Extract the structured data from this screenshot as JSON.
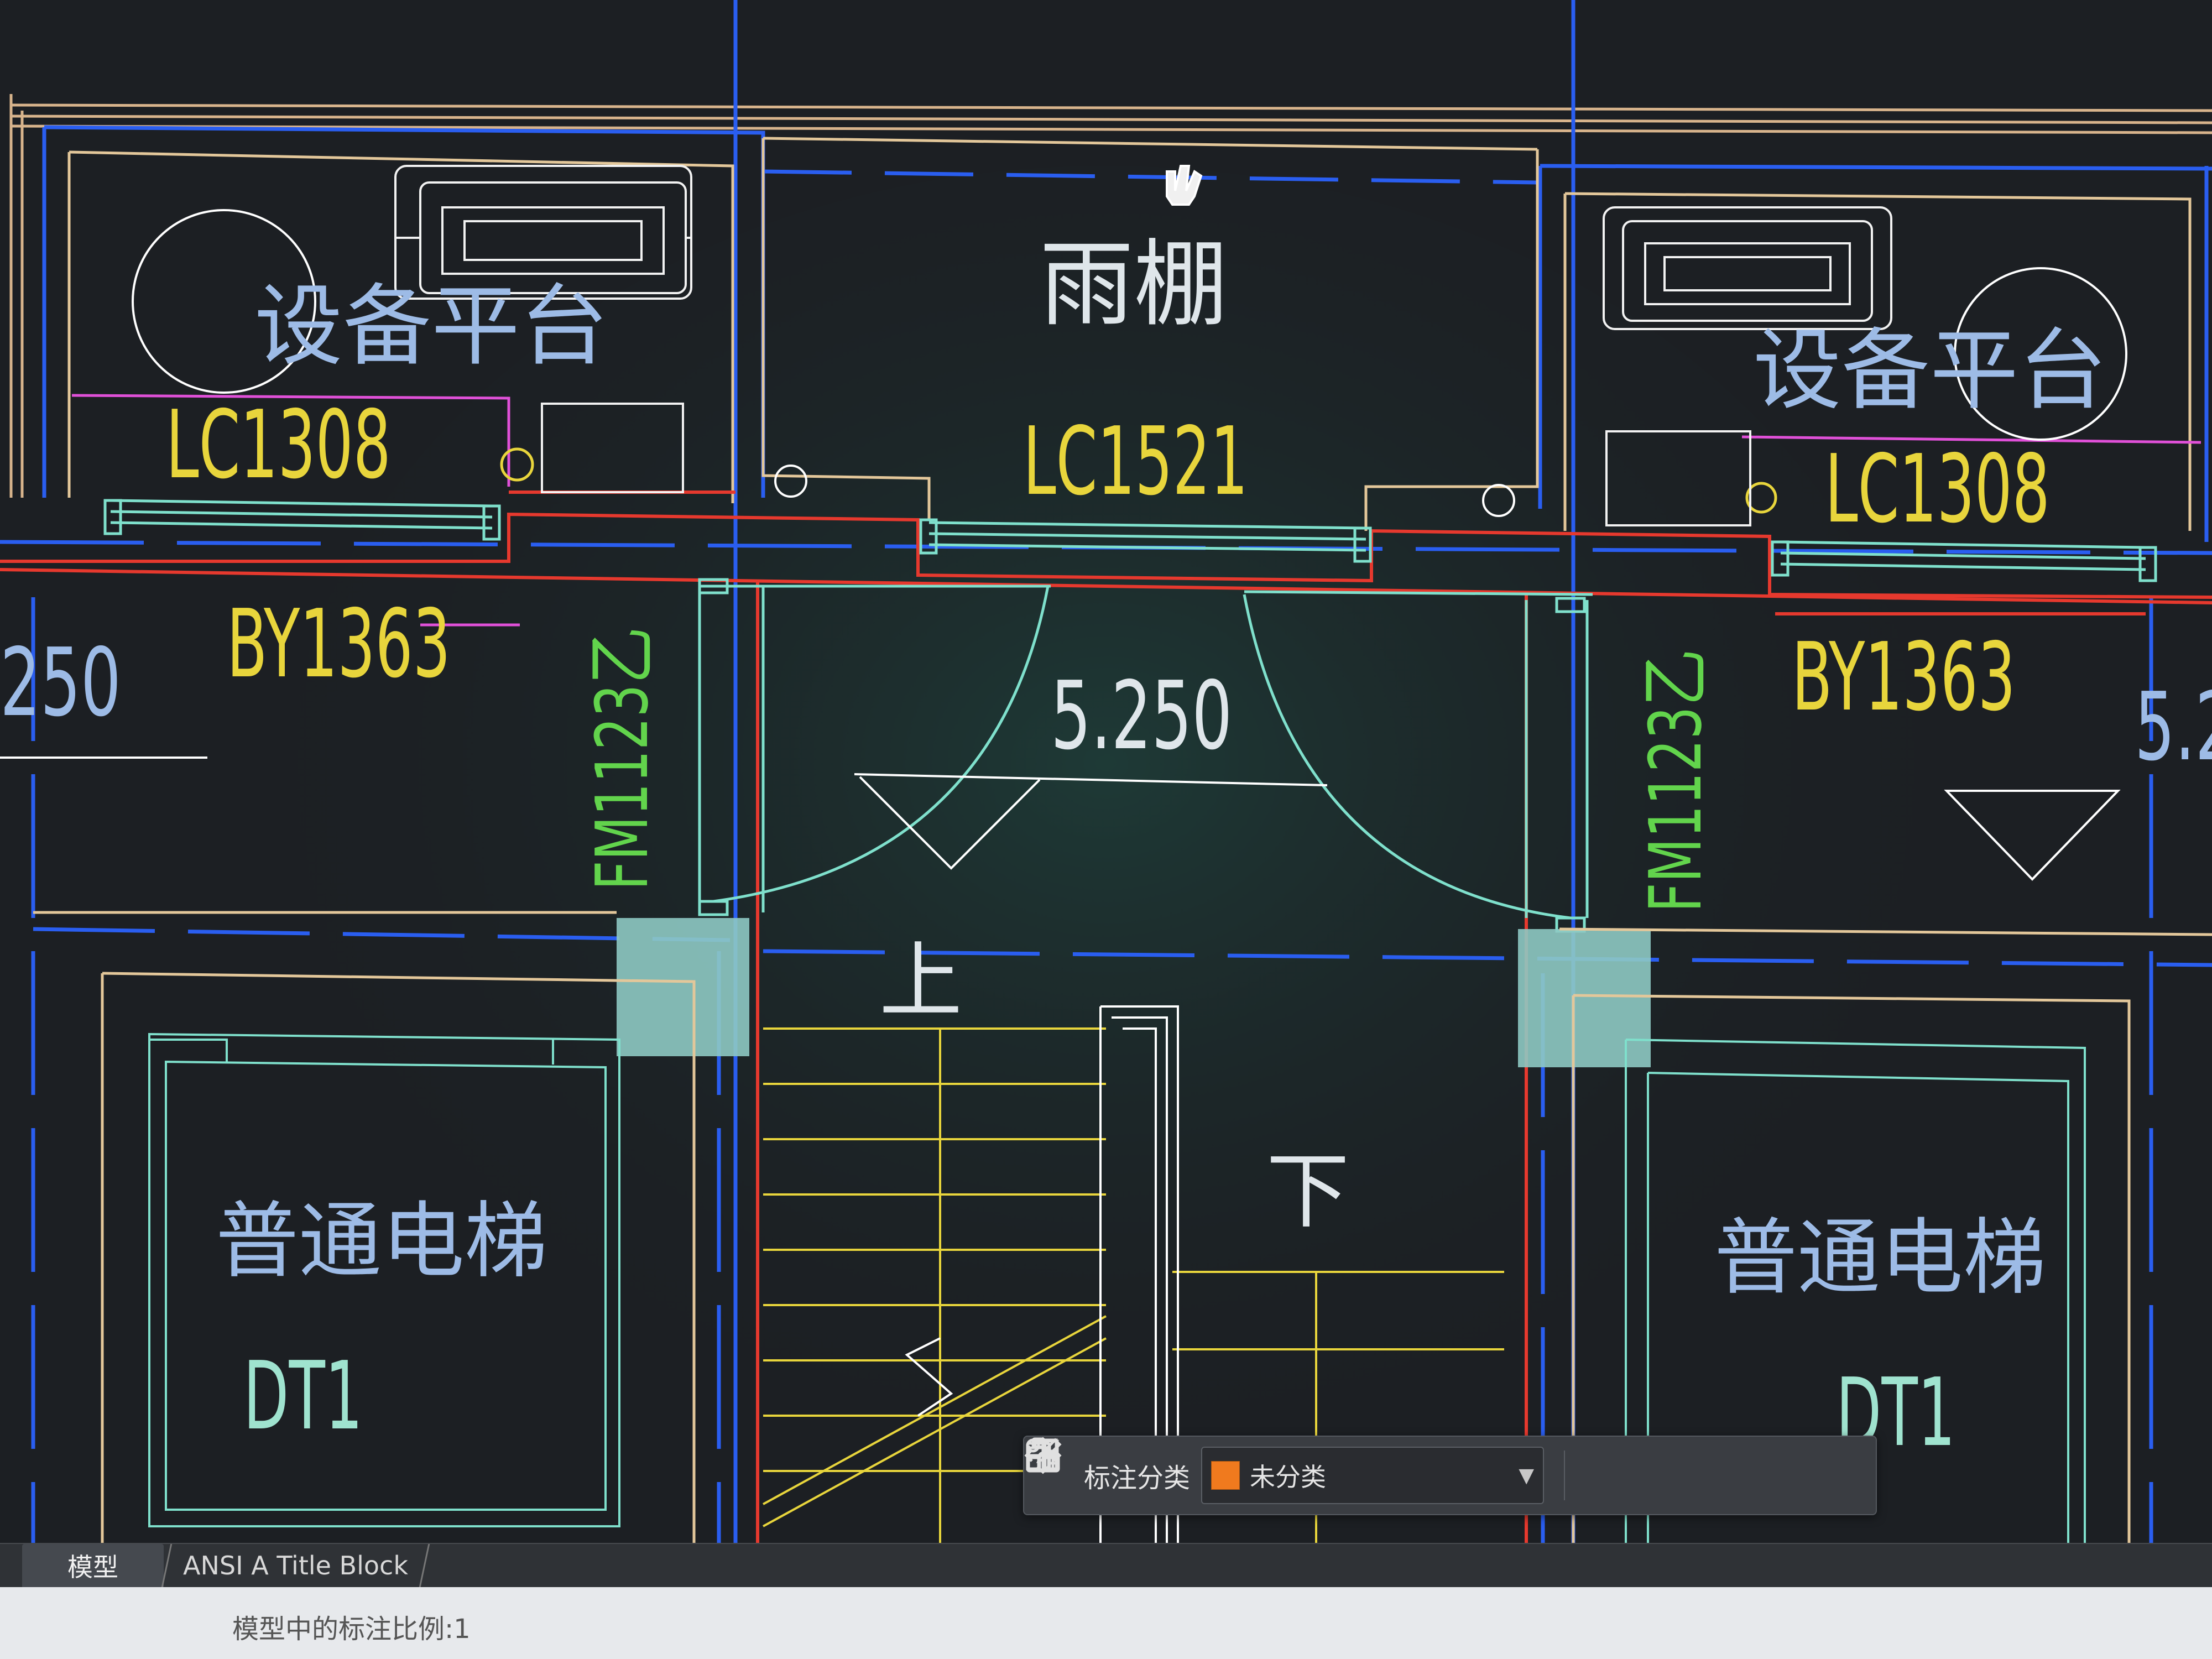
{
  "drawing": {
    "rooms": {
      "canopy": "雨棚",
      "platform_left": "设备平台",
      "platform_right": "设备平台",
      "elevator_left": "普通电梯",
      "elevator_right": "普通电梯"
    },
    "windows": {
      "left": "LC1308",
      "center": "LC1521",
      "right": "LC1308"
    },
    "walls": {
      "left": "BY1363",
      "right": "BY1363"
    },
    "doors": {
      "left": "FM1123乙",
      "right": "FM1123乙"
    },
    "elevators": {
      "left": "DT1",
      "right": "DT1"
    },
    "elevation": "5.250",
    "edge_elevation_left": "250",
    "edge_elevation_right": "5.2",
    "stair_up": "上",
    "stair_down": "下"
  },
  "toolbar": {
    "category_label": "标注分类",
    "category_value": "未分类",
    "swatch_color": "#f07a1e",
    "icons": [
      "grid-icon",
      "edit-icon",
      "move-icon",
      "copy-icon",
      "paste-icon"
    ]
  },
  "tabs": [
    {
      "label": "模型"
    },
    {
      "label": "ANSI A Title Block"
    }
  ],
  "status": {
    "text": "模型中的标注比例:1"
  }
}
